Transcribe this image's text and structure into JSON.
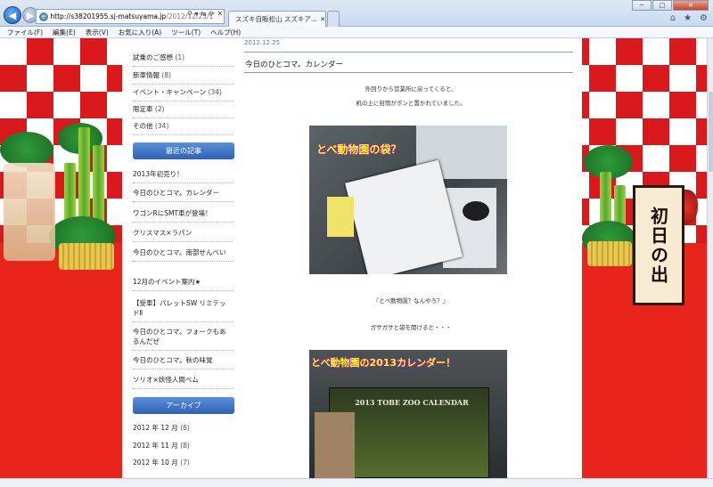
{
  "browser": {
    "address_host": "http://s38201955.sj-matsuyama.jp",
    "address_path": "/2012/12/25/1",
    "tab_title": "スズキ自販松山 スズキア...",
    "address_controls": "⚲ ▾ ⇆ ⟳ ✕"
  },
  "menu": [
    "ファイル(F)",
    "編集(E)",
    "表示(V)",
    "お気に入り(A)",
    "ツール(T)",
    "ヘルプ(H)"
  ],
  "sidebar": {
    "categories": [
      {
        "label": "試乗のご感想",
        "count": "(1)"
      },
      {
        "label": "新車情報",
        "count": "(8)"
      },
      {
        "label": "イベント・キャンペーン",
        "count": "(34)"
      },
      {
        "label": "限定車",
        "count": "(2)"
      },
      {
        "label": "その他",
        "count": "(34)"
      }
    ],
    "recent_heading": "最近の記事",
    "recent": [
      "2013年初売り！",
      "今日のひとコマ。カレンダー",
      "ワゴンRにSMT車が登場！",
      "クリスマス×ラパン",
      "今日のひとコマ。南部せんべい",
      "12月のイベント案内★",
      "【受車】パレットSW リミテッドⅡ",
      "今日のひとコマ。フォークもあるんだぜ",
      "今日のひとコマ。秋の味覚",
      "ソリオ×妖怪人間べム"
    ],
    "archive_heading": "アーカイブ",
    "archive": [
      {
        "label": "2012 年 12 月",
        "count": "(6)"
      },
      {
        "label": "2012 年 11 月",
        "count": "(8)"
      },
      {
        "label": "2012 年 10 月",
        "count": "(7)"
      }
    ]
  },
  "post": {
    "date": "2012.12.25",
    "title": "今日のひとコマ。カレンダー",
    "line1": "外回りから営業所に戻ってくると、",
    "line2": "机の上に封筒がポンと置かれていました。",
    "photo1_caption": "とべ動物園の袋？",
    "line3": "『とべ動物園？なんやろ？』",
    "line4": "ガサガサと袋を開けると・・・",
    "photo2_caption": "とべ動物園の2013カレンダー！",
    "photo2_inner_text": "2013 TOBE ZOO CALENDAR"
  },
  "decoration": {
    "sign_text": "初日の出"
  },
  "colors": {
    "background_red": "#e8241d",
    "sidebar_heading_blue": "#2f62b5",
    "caption_yellow": "#fff233"
  }
}
